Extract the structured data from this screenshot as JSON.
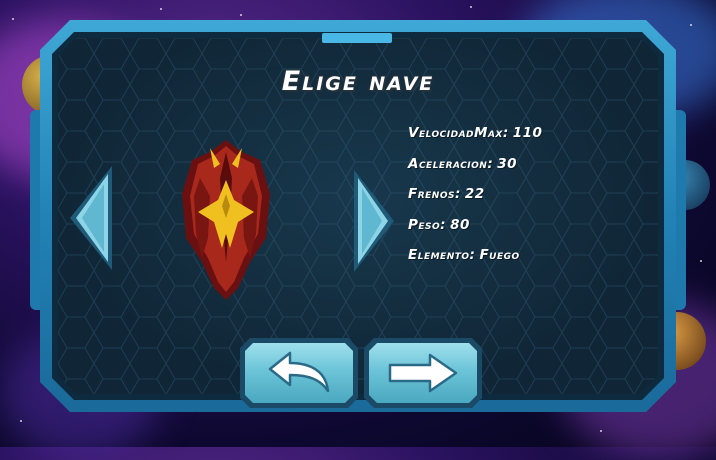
{
  "screen": {
    "title": "Elige nave"
  },
  "ship": {
    "stats": [
      {
        "label": "VelocidadMax:",
        "value": "110"
      },
      {
        "label": "Aceleracion:",
        "value": "30"
      },
      {
        "label": "Frenos:",
        "value": "22"
      },
      {
        "label": "Peso:",
        "value": "80"
      },
      {
        "label": "Elemento:",
        "value": "Fuego"
      }
    ]
  },
  "controls": {
    "prev_icon": "triangle-left-icon",
    "next_icon": "triangle-right-icon",
    "back_icon": "curved-back-arrow-icon",
    "confirm_icon": "right-arrow-icon"
  },
  "colors": {
    "frame": "#2282b6",
    "panel": "#102636",
    "button": "#6cc4d8",
    "ship_red": "#a8281c",
    "ship_yellow": "#f0c020"
  }
}
